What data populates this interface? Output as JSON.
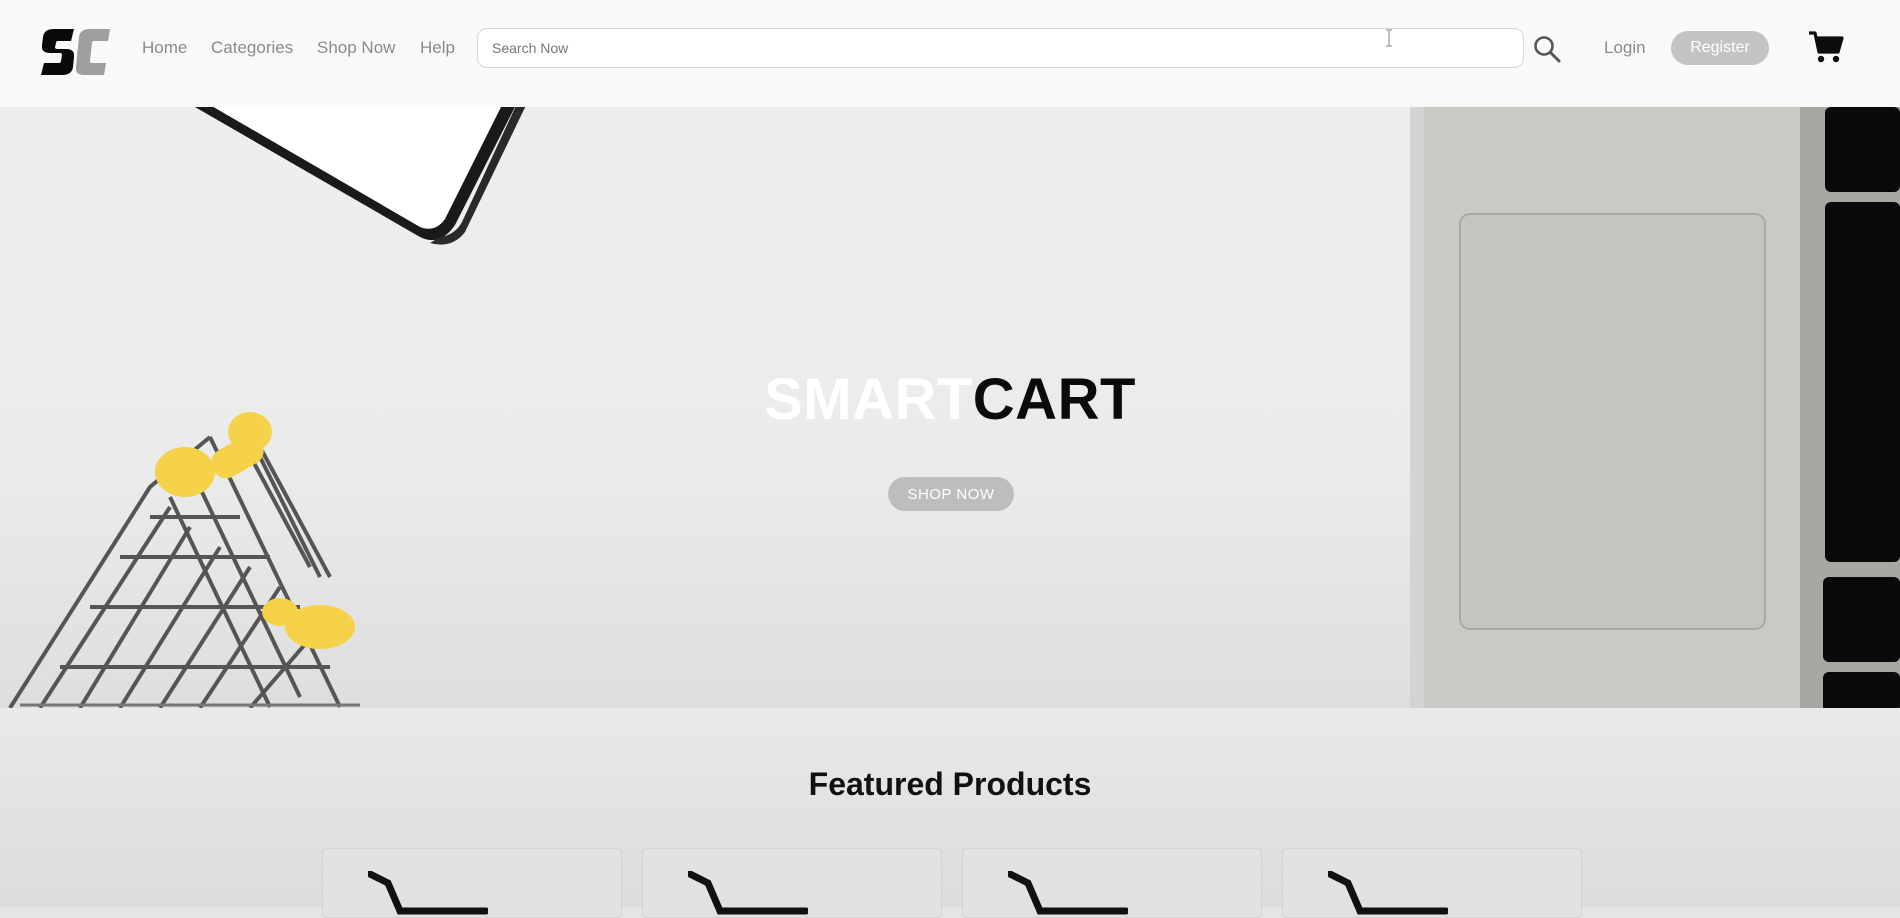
{
  "header": {
    "logo_text": "SC",
    "nav": [
      {
        "label": "Home"
      },
      {
        "label": "Categories"
      },
      {
        "label": "Shop Now"
      },
      {
        "label": "Help"
      }
    ],
    "search": {
      "placeholder": "Search Now",
      "value": ""
    },
    "login_label": "Login",
    "register_label": "Register",
    "icons": {
      "search": "search-icon",
      "cart": "cart-icon"
    }
  },
  "hero": {
    "title_part1": "SMART",
    "title_part2": "CART",
    "cta_label": "SHOP NOW"
  },
  "featured": {
    "title": "Featured Products",
    "products": [
      {
        "icon": "shopping-cart-icon"
      },
      {
        "icon": "shopping-cart-icon"
      },
      {
        "icon": "shopping-cart-icon"
      },
      {
        "icon": "shopping-cart-icon"
      }
    ]
  },
  "colors": {
    "header_bg": "#f9f9f8",
    "button_gray": "#c3c3c3",
    "hero_bg": "#ececec",
    "title_white": "#ffffff",
    "title_black": "#0b0b0b",
    "cart_yellow": "#f5d24a"
  }
}
